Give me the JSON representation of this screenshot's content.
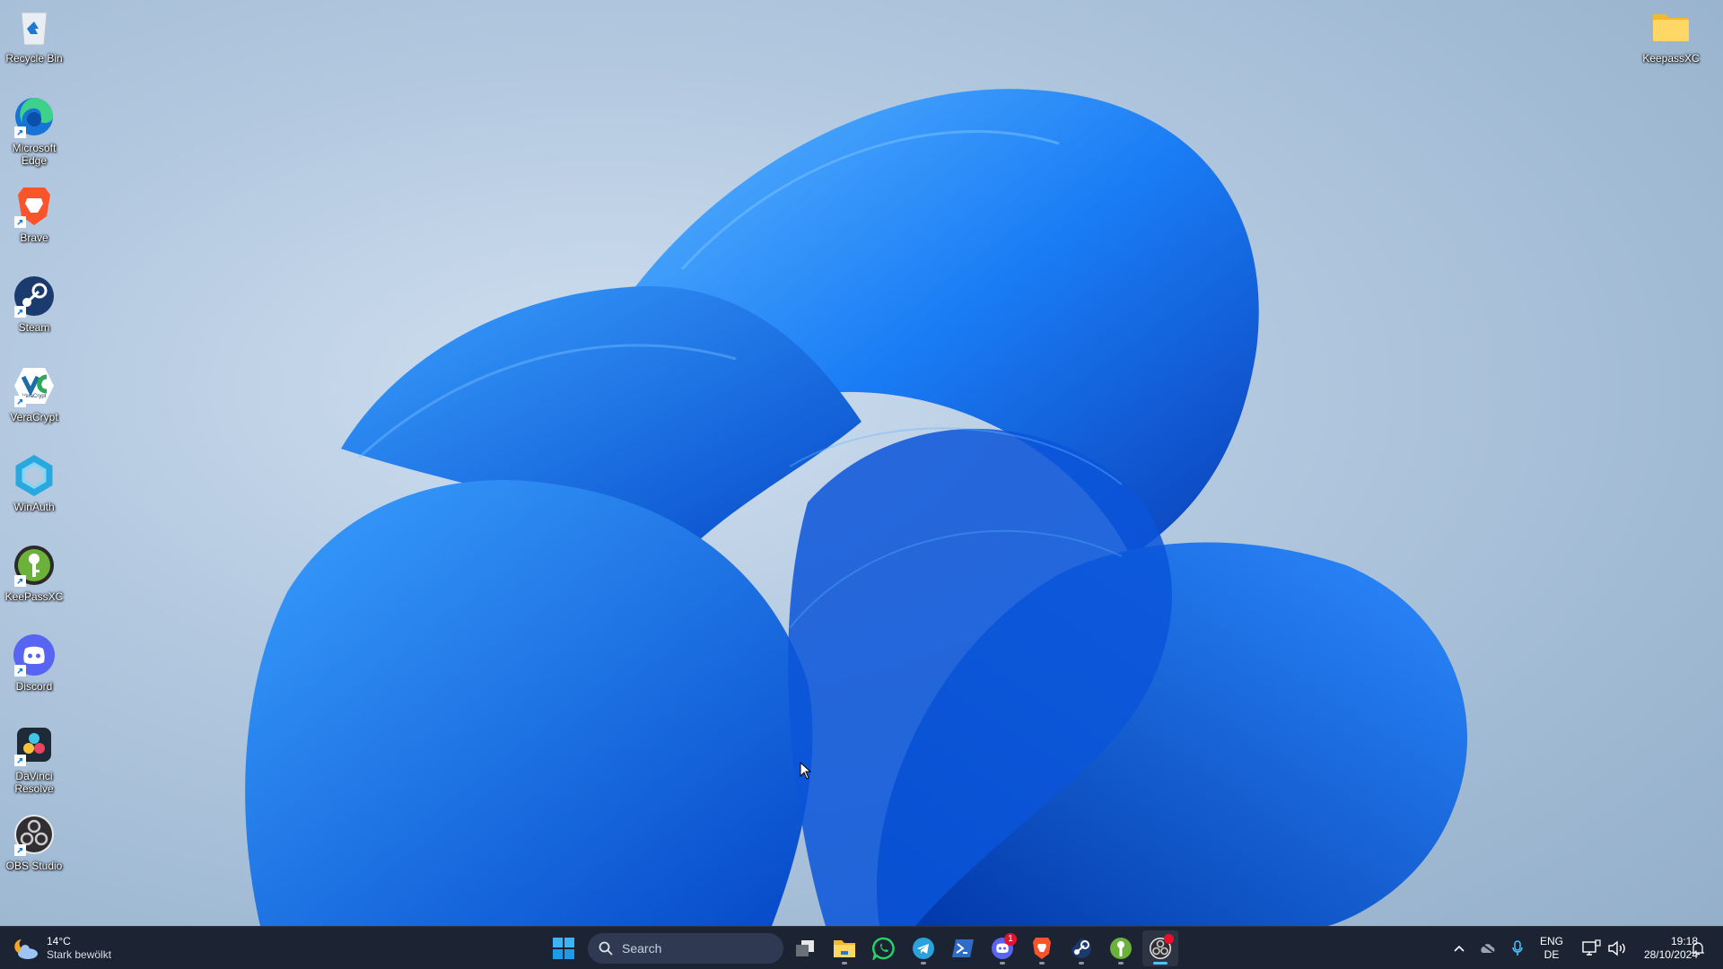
{
  "desktop": {
    "icons_left": [
      {
        "label": "Recycle Bin",
        "icon": "recycle-bin-icon",
        "shortcut": false
      },
      {
        "label": "Microsoft Edge",
        "icon": "edge-icon",
        "shortcut": true
      },
      {
        "label": "Brave",
        "icon": "brave-icon",
        "shortcut": true
      },
      {
        "label": "Steam",
        "icon": "steam-icon",
        "shortcut": true
      },
      {
        "label": "VeraCrypt",
        "icon": "veracrypt-icon",
        "shortcut": true
      },
      {
        "label": "WinAuth",
        "icon": "winauth-icon",
        "shortcut": false
      },
      {
        "label": "KeePassXC",
        "icon": "keepassxc-icon",
        "shortcut": true
      },
      {
        "label": "Discord",
        "icon": "discord-icon",
        "shortcut": true
      },
      {
        "label": "DaVinci Resolve",
        "icon": "davinci-resolve-icon",
        "shortcut": true
      },
      {
        "label": "OBS Studio",
        "icon": "obs-studio-icon",
        "shortcut": true
      }
    ],
    "icons_right": [
      {
        "label": "KeepassXC",
        "icon": "folder-icon",
        "shortcut": false
      }
    ],
    "veracrypt_logo_text": "VeraCrypt"
  },
  "taskbar": {
    "weather": {
      "temperature": "14°C",
      "condition": "Stark bewölkt",
      "icon": "partly-cloudy-night-icon"
    },
    "start_icon": "windows-start-icon",
    "search": {
      "placeholder": "Search",
      "icon": "search-icon"
    },
    "apps": [
      {
        "name": "Task View",
        "icon": "task-view-icon",
        "running": false
      },
      {
        "name": "File Explorer",
        "icon": "file-explorer-icon",
        "running": true
      },
      {
        "name": "WhatsApp",
        "icon": "whatsapp-icon",
        "running": false
      },
      {
        "name": "Telegram",
        "icon": "telegram-icon",
        "running": true
      },
      {
        "name": "PowerShell",
        "icon": "powershell-icon",
        "running": false
      },
      {
        "name": "Discord",
        "icon": "discord-icon",
        "running": true,
        "badge": "1"
      },
      {
        "name": "Brave",
        "icon": "brave-icon",
        "running": true
      },
      {
        "name": "Steam",
        "icon": "steam-icon",
        "running": true
      },
      {
        "name": "KeePassXC",
        "icon": "keepassxc-icon",
        "running": true
      },
      {
        "name": "OBS Studio",
        "icon": "obs-studio-icon",
        "running": true,
        "active": true,
        "recording": true
      }
    ],
    "tray": {
      "show_hidden_icon": "chevron-up-icon",
      "cloud_icon": "onedrive-offline-icon",
      "mic_icon": "microphone-icon",
      "language": "ENG",
      "keyboard_layout": "DE",
      "network_icon": "network-wired-icon",
      "volume_icon": "volume-icon",
      "time": "19:18",
      "date": "28/10/2024",
      "notification_icon": "bell-icon"
    }
  },
  "colors": {
    "taskbar_bg": "#1c2433",
    "accent": "#4cc2ff",
    "wallpaper_bloom": "#0a6cf0",
    "badge_red": "#e8112d"
  }
}
